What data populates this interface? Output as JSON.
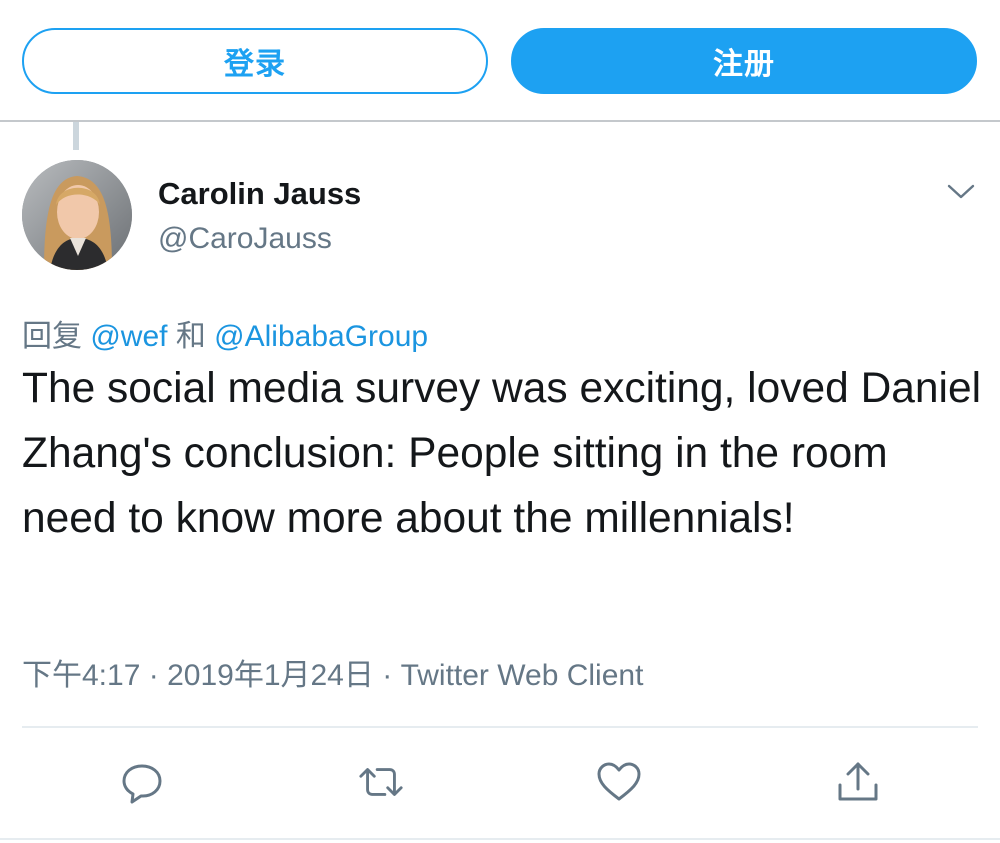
{
  "header": {
    "login_label": "登录",
    "signup_label": "注册"
  },
  "tweet": {
    "author": {
      "display_name": "Carolin Jauss",
      "handle": "@CaroJauss"
    },
    "reply": {
      "prefix": "回复",
      "mentions": [
        "@wef",
        "@AlibabaGroup"
      ],
      "conjunction": "和"
    },
    "text": "The social media survey was exciting, loved Daniel Zhang's conclusion: People sitting in the room need to know more about the millennials!",
    "meta": {
      "time": "下午4:17",
      "separator": "·",
      "date": "2019年1月24日",
      "client": "Twitter Web Client"
    },
    "actions": {
      "reply_icon": "reply-icon",
      "retweet_icon": "retweet-icon",
      "like_icon": "heart-icon",
      "share_icon": "share-icon"
    }
  },
  "colors": {
    "accent": "#1da1f2",
    "mention": "#1b95e0",
    "secondary_text": "#657786",
    "primary_text": "#14171a",
    "divider": "#e6ecf0"
  }
}
